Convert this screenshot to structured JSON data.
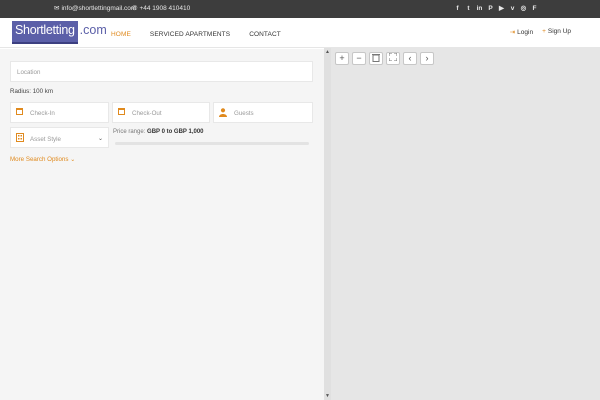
{
  "topbar": {
    "email": "info@shortlettingmail.com",
    "phone": "+44 1908 410410",
    "socials": [
      "facebook-icon",
      "twitter-icon",
      "linkedin-icon",
      "pinterest-icon",
      "youtube-icon",
      "vimeo-icon",
      "instagram-icon",
      "foursquare-icon"
    ]
  },
  "header": {
    "logo_main": "Shortletting",
    "logo_suffix": ".com",
    "nav": [
      "HOME",
      "SERVICED APARTMENTS",
      "CONTACT"
    ],
    "login": "Login",
    "signup": "Sign Up",
    "accent": "#e08a1e"
  },
  "search": {
    "location_placeholder": "Location",
    "radius": "Radius: 100 km",
    "checkin": "Check-In",
    "checkout": "Check-Out",
    "guests": "Guests",
    "asset_style": "Asset Style",
    "price_label": "Price range:",
    "price_value": "GBP 0 to GBP 1,000",
    "more": "More Search Options"
  },
  "map": {
    "controls": [
      "zoom-in",
      "zoom-out",
      "trash",
      "fullscreen",
      "previous",
      "next"
    ]
  }
}
